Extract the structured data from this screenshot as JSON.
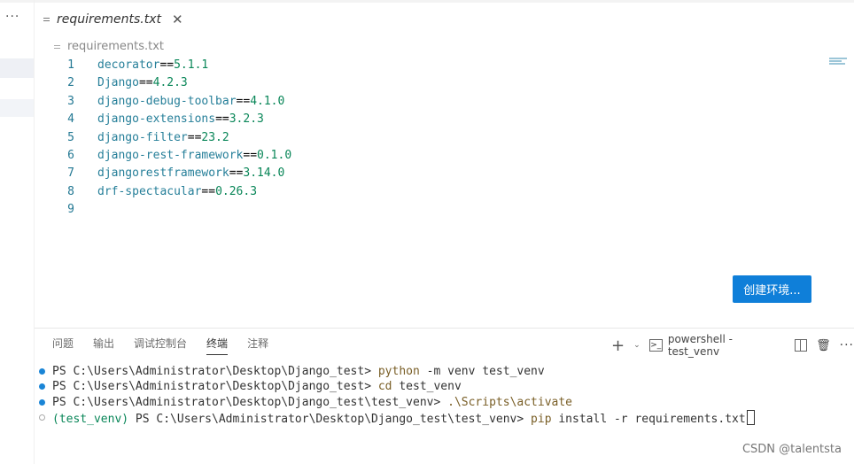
{
  "sidebar": {
    "more_label": "···"
  },
  "tab": {
    "title": "requirements.txt",
    "close": "✕",
    "icon": "file-icon"
  },
  "breadcrumb": {
    "file": "requirements.txt",
    "icon": "file-icon"
  },
  "editor": {
    "lines": [
      {
        "num": "1",
        "pkg": "decorator",
        "op": "==",
        "ver": "5.1.1"
      },
      {
        "num": "2",
        "pkg": "Django",
        "op": "==",
        "ver": "4.2.3"
      },
      {
        "num": "3",
        "pkg": "django-debug-toolbar",
        "op": "==",
        "ver": "4.1.0"
      },
      {
        "num": "4",
        "pkg": "django-extensions",
        "op": "==",
        "ver": "3.2.3"
      },
      {
        "num": "5",
        "pkg": "django-filter",
        "op": "==",
        "ver": "23.2"
      },
      {
        "num": "6",
        "pkg": "django-rest-framework",
        "op": "==",
        "ver": "0.1.0"
      },
      {
        "num": "7",
        "pkg": "djangorestframework",
        "op": "==",
        "ver": "3.14.0"
      },
      {
        "num": "8",
        "pkg": "drf-spectacular",
        "op": "==",
        "ver": "0.26.3"
      },
      {
        "num": "9",
        "pkg": "",
        "op": "",
        "ver": ""
      }
    ]
  },
  "create_env_button": "创建环境...",
  "panel": {
    "tabs": [
      "问题",
      "输出",
      "调试控制台",
      "终端",
      "注释"
    ],
    "active_tab": "终端",
    "new_terminal": "+",
    "dropdown": "⌄",
    "terminal_name": "powershell - test_venv",
    "terminal_icon": ">_",
    "split_icon": "split-icon",
    "trash": "🗑",
    "more": "···"
  },
  "terminal": {
    "lines": [
      {
        "status": "done",
        "prompt": "PS C:\\Users\\Administrator\\Desktop\\Django_test> ",
        "cmd": "python",
        "args": " -m venv test_venv"
      },
      {
        "status": "done",
        "prompt": "PS C:\\Users\\Administrator\\Desktop\\Django_test> ",
        "cmd": "cd",
        "args": " test_venv"
      },
      {
        "status": "done",
        "prompt": "PS C:\\Users\\Administrator\\Desktop\\Django_test\\test_venv> ",
        "cmd": ".\\Scripts\\activate",
        "args": ""
      },
      {
        "status": "active",
        "venv": "(test_venv)",
        "prompt": " PS C:\\Users\\Administrator\\Desktop\\Django_test\\test_venv> ",
        "cmd": "pip",
        "args": " install -r requirements.txt"
      }
    ]
  },
  "watermark": "CSDN @talentsta",
  "colors": {
    "accent": "#0f7fd9",
    "line_number": "#237893",
    "package": "#267f99",
    "version": "#098658"
  }
}
